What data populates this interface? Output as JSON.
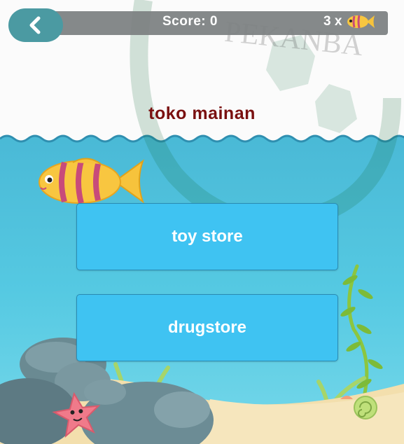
{
  "header": {
    "back_icon": "chevron-left-icon",
    "score_text": "Score: 0",
    "lives_text": "3 x",
    "lives_icon": "fish-icon"
  },
  "watermark_text": "PEKANBA",
  "question": {
    "word": "toko mainan"
  },
  "answers": [
    {
      "label": "toy store"
    },
    {
      "label": "drugstore"
    }
  ],
  "colors": {
    "water": "#4fc6e0",
    "sand": "#f3dfad",
    "button": "#3fc3f2",
    "question_text": "#7a1010",
    "header_bar": "#7b7f80",
    "back_button": "#4b9aa2"
  }
}
